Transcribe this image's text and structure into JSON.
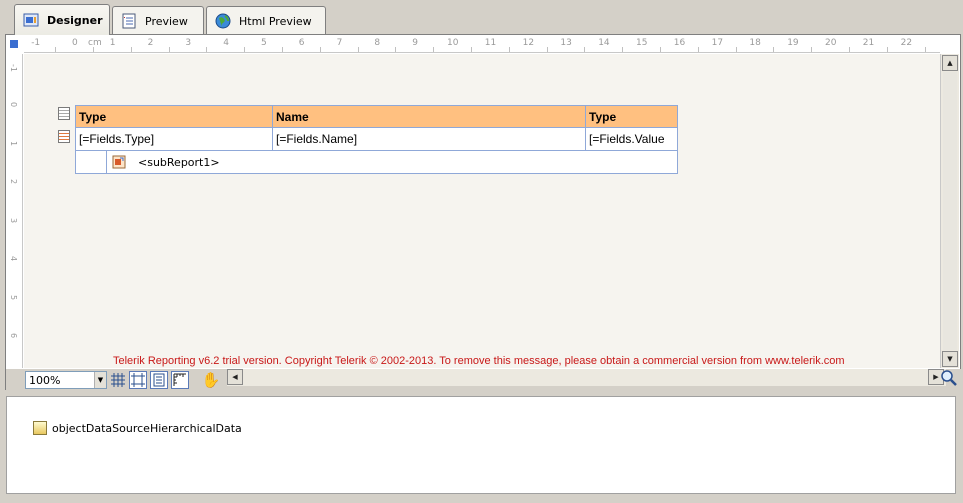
{
  "tabs": [
    {
      "label": "Designer",
      "icon": "designer-icon",
      "active": true
    },
    {
      "label": "Preview",
      "icon": "preview-icon",
      "active": false
    },
    {
      "label": "Html Preview",
      "icon": "globe-icon",
      "active": false
    }
  ],
  "ruler": {
    "unit": "cm",
    "h_labels": [
      "-1",
      "0",
      "1",
      "2",
      "3",
      "4",
      "5",
      "6",
      "7",
      "8",
      "9",
      "10",
      "11",
      "12",
      "13",
      "14",
      "15",
      "16",
      "17",
      "18",
      "19",
      "20",
      "21",
      "22"
    ],
    "v_labels": [
      "-1",
      "0",
      "1",
      "2",
      "3",
      "4",
      "5",
      "6"
    ]
  },
  "table": {
    "headers": [
      "Type",
      "Name",
      "Type"
    ],
    "fields": [
      "[=Fields.Type]",
      "[=Fields.Name]",
      "[=Fields.Value"
    ],
    "subreport": "<subReport1>"
  },
  "trial_message": "Telerik Reporting v6.2 trial version. Copyright Telerik © 2002-2013. To remove this message, please obtain a commercial version from www.telerik.com",
  "toolbar": {
    "zoom": "100%"
  },
  "components": {
    "datasource": "objectDataSourceHierarchicalData"
  },
  "colors": {
    "header_fill": "#ffc080",
    "trial_text": "#c81818",
    "cell_border": "#8fa8d8"
  }
}
